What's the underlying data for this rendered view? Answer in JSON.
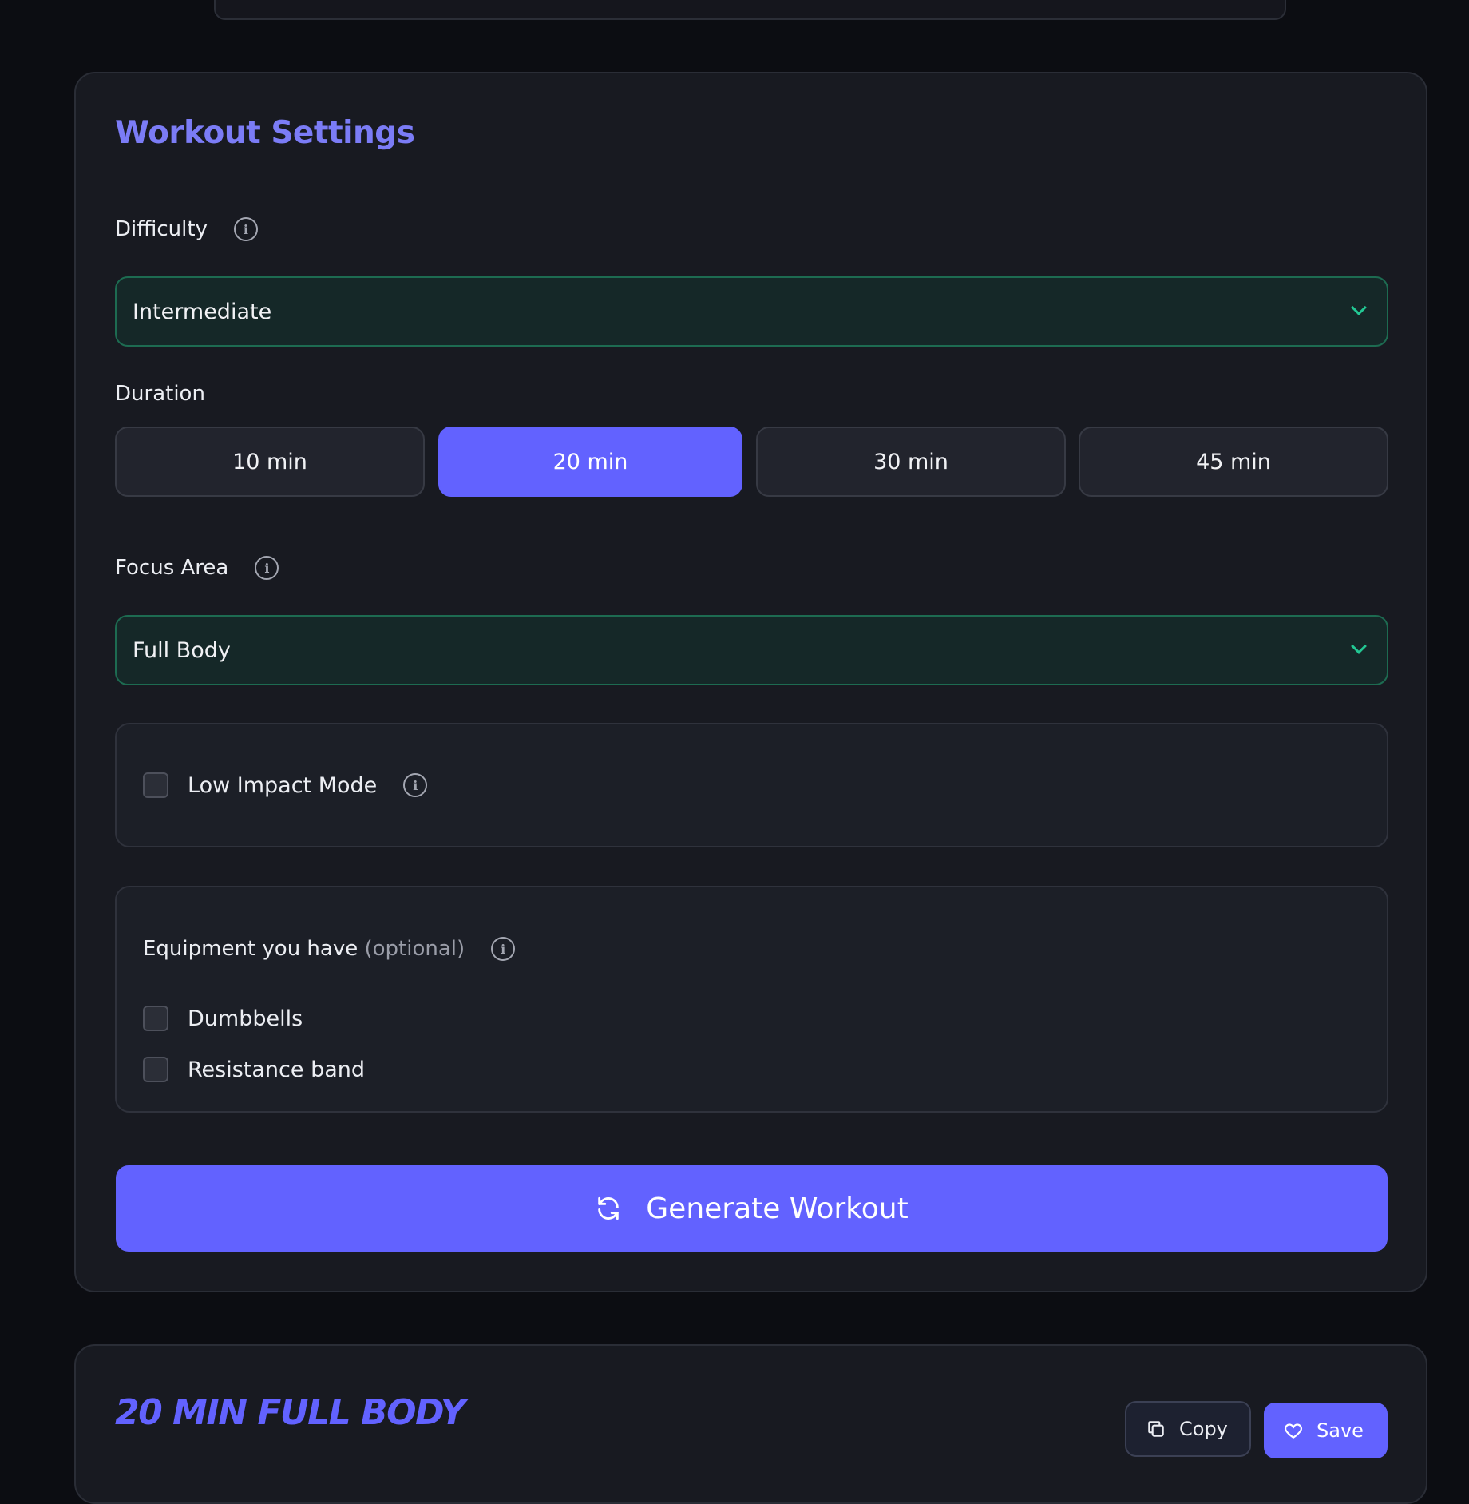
{
  "settings": {
    "title": "Workout Settings",
    "difficulty": {
      "label": "Difficulty",
      "value": "Intermediate"
    },
    "duration": {
      "label": "Duration",
      "options": [
        "10 min",
        "20 min",
        "30 min",
        "45 min"
      ],
      "selected": "20 min"
    },
    "focus": {
      "label": "Focus Area",
      "value": "Full Body"
    },
    "low_impact": {
      "label": "Low Impact Mode",
      "checked": false
    },
    "equipment": {
      "label": "Equipment you have",
      "optional": "(optional)",
      "items": [
        {
          "label": "Dumbbells",
          "checked": false
        },
        {
          "label": "Resistance band",
          "checked": false
        }
      ]
    },
    "generate_label": "Generate Workout"
  },
  "result": {
    "title": "20 MIN FULL BODY",
    "copy_label": "Copy",
    "save_label": "Save"
  },
  "colors": {
    "accent": "#6262ff",
    "select_border": "#1d6b51",
    "chevron": "#22c793",
    "background": "#0c0d12",
    "card": "#181a21"
  },
  "icons": {
    "info": "info-circle-icon",
    "chevron": "chevron-down-icon",
    "refresh": "refresh-icon",
    "copy": "copy-icon",
    "save": "heart-icon"
  }
}
